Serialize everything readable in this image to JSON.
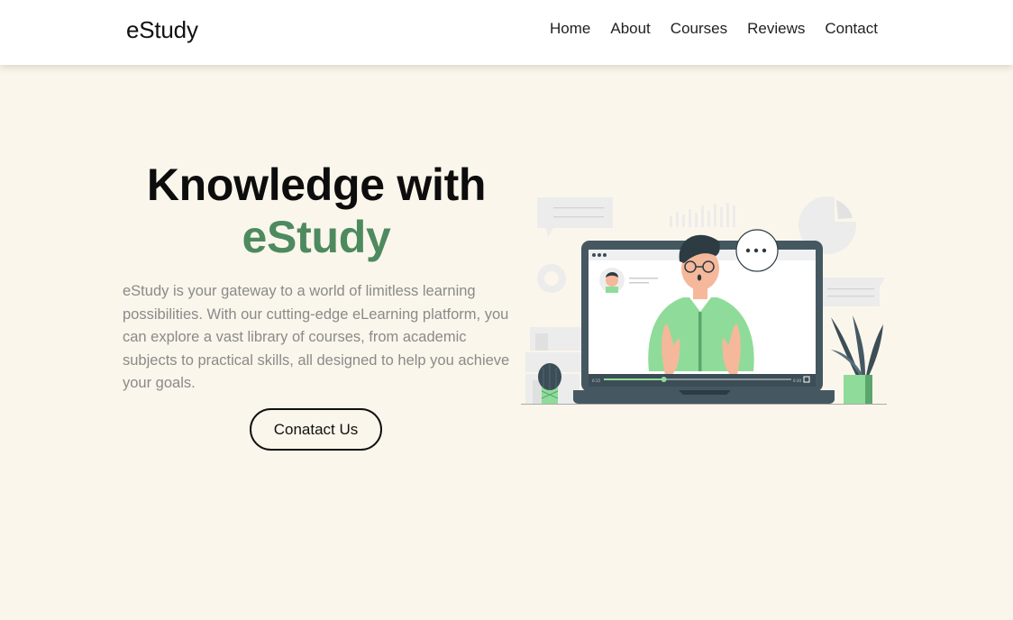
{
  "header": {
    "logo": "eStudy",
    "nav": [
      {
        "label": "Home"
      },
      {
        "label": "About"
      },
      {
        "label": "Courses"
      },
      {
        "label": "Reviews"
      },
      {
        "label": "Contact"
      }
    ]
  },
  "hero": {
    "title_line1": "Knowledge with",
    "title_line2": "eStudy",
    "description": "eStudy is your gateway to a world of limitless learning possibilities. With our cutting-edge eLearning platform, you can explore a vast library of courses, from academic subjects to practical skills, all designed to help you achieve your goals.",
    "cta_label": "Conatact Us"
  },
  "illustration": {
    "subject": "teacher on laptop video call",
    "video_progress": 0.32,
    "player_time_left": "0:15",
    "player_time_right": "0:30"
  },
  "colors": {
    "page_background": "#fbf6eb",
    "header_background": "#ffffff",
    "brand_green": "#4e8a5f",
    "illustration_green": "#8fdc9a",
    "laptop_dark": "#455862"
  }
}
